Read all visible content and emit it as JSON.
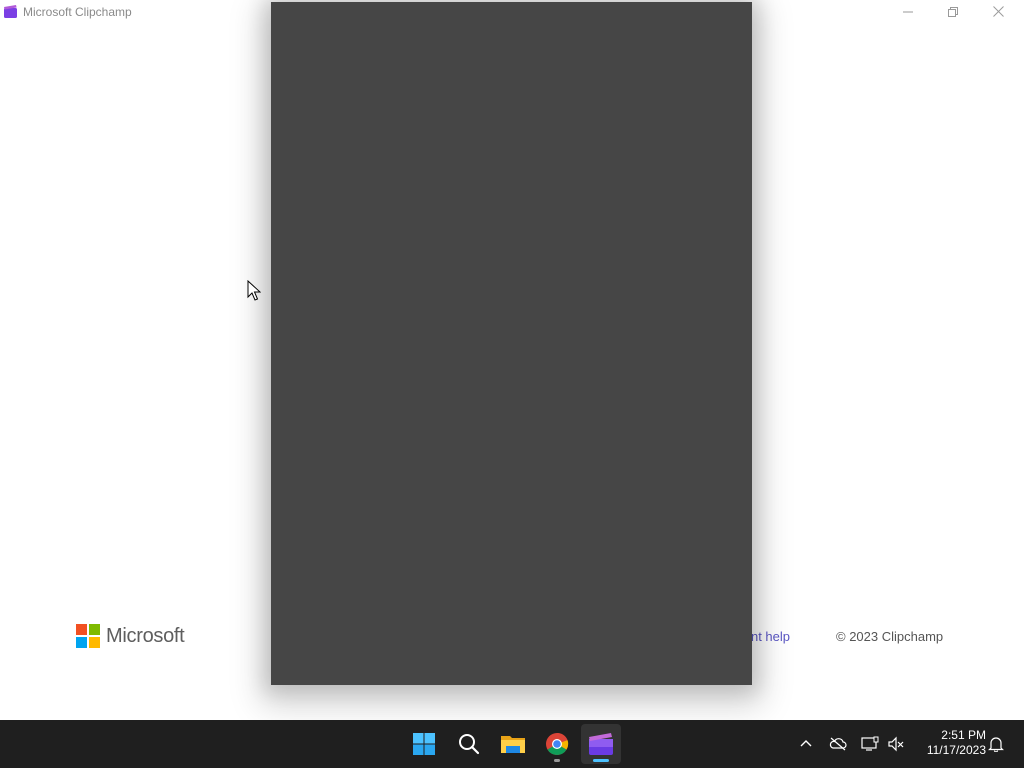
{
  "window": {
    "title": "Microsoft Clipchamp",
    "controls": {
      "minimize": "minimize-icon",
      "maximize": "restore-icon",
      "close": "close-icon"
    }
  },
  "footer": {
    "brand": "Microsoft",
    "link": "count help",
    "copyright": "© 2023 Clipchamp",
    "link_color": "#5b57c4"
  },
  "panel": {
    "color": "#464646"
  },
  "taskbar": {
    "items": [
      "windows-start-icon",
      "search-icon",
      "file-explorer-icon",
      "chrome-icon",
      "clipchamp-icon"
    ],
    "tray": [
      "chevron-up-icon",
      "onedrive-offline-icon",
      "network-icon",
      "volume-muted-icon",
      "notification-bell-icon"
    ],
    "time": "2:51 PM",
    "date": "11/17/2023"
  }
}
